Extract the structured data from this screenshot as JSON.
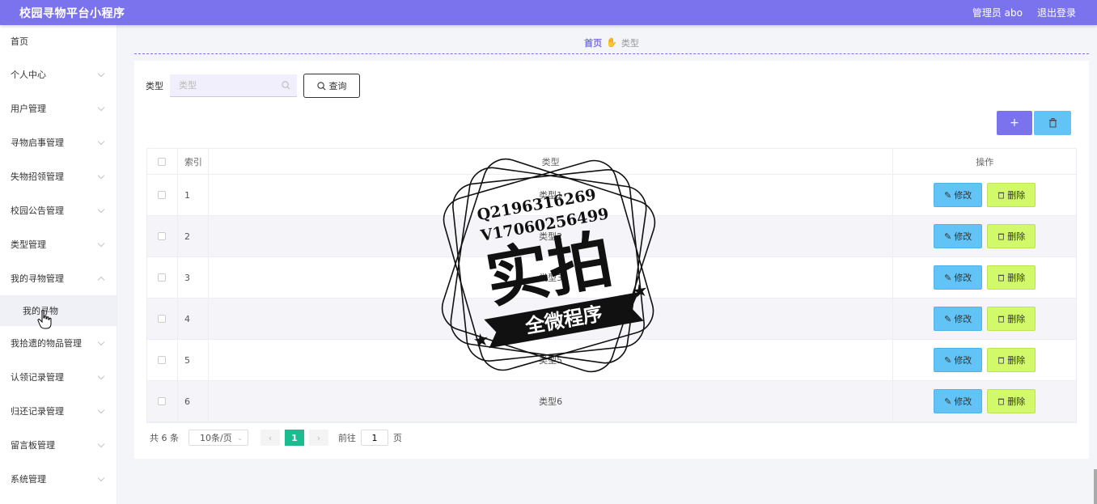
{
  "header": {
    "title": "校园寻物平台小程序",
    "admin": "管理员 abo",
    "logout": "退出登录"
  },
  "sidebar": {
    "items": [
      {
        "label": "首页"
      },
      {
        "label": "个人中心"
      },
      {
        "label": "用户管理"
      },
      {
        "label": "寻物启事管理"
      },
      {
        "label": "失物招领管理"
      },
      {
        "label": "校园公告管理"
      },
      {
        "label": "类型管理"
      },
      {
        "label": "我的寻物管理"
      },
      {
        "label": "我的寻物"
      },
      {
        "label": "我拾遗的物品管理"
      },
      {
        "label": "认领记录管理"
      },
      {
        "label": "归还记录管理"
      },
      {
        "label": "留言板管理"
      },
      {
        "label": "系统管理"
      }
    ]
  },
  "breadcrumb": {
    "home": "首页",
    "current": "类型"
  },
  "search": {
    "label": "类型",
    "placeholder": "类型",
    "button": "查询"
  },
  "table": {
    "headers": {
      "index": "索引",
      "type": "类型",
      "actions": "操作"
    },
    "rows": [
      {
        "index": "1",
        "type": "类型1"
      },
      {
        "index": "2",
        "type": "类型2"
      },
      {
        "index": "3",
        "type": "类型3"
      },
      {
        "index": "4",
        "type": "类型4"
      },
      {
        "index": "5",
        "type": "类型5"
      },
      {
        "index": "6",
        "type": "类型6"
      }
    ],
    "edit_label": "修改",
    "delete_label": "删除"
  },
  "pagination": {
    "total": "共 6 条",
    "page_size": "10条/页",
    "current_page": "1",
    "goto_prefix": "前往",
    "goto_value": "1",
    "goto_suffix": "页"
  },
  "watermark": {
    "line1": "Q2196316269",
    "line2": "V17060256499",
    "big": "实拍",
    "ribbon": "全微程序"
  },
  "colors": {
    "accent": "#7b73ee",
    "edit": "#62c4f6",
    "delete": "#d2f96a",
    "page_active": "#1bbc8f"
  }
}
